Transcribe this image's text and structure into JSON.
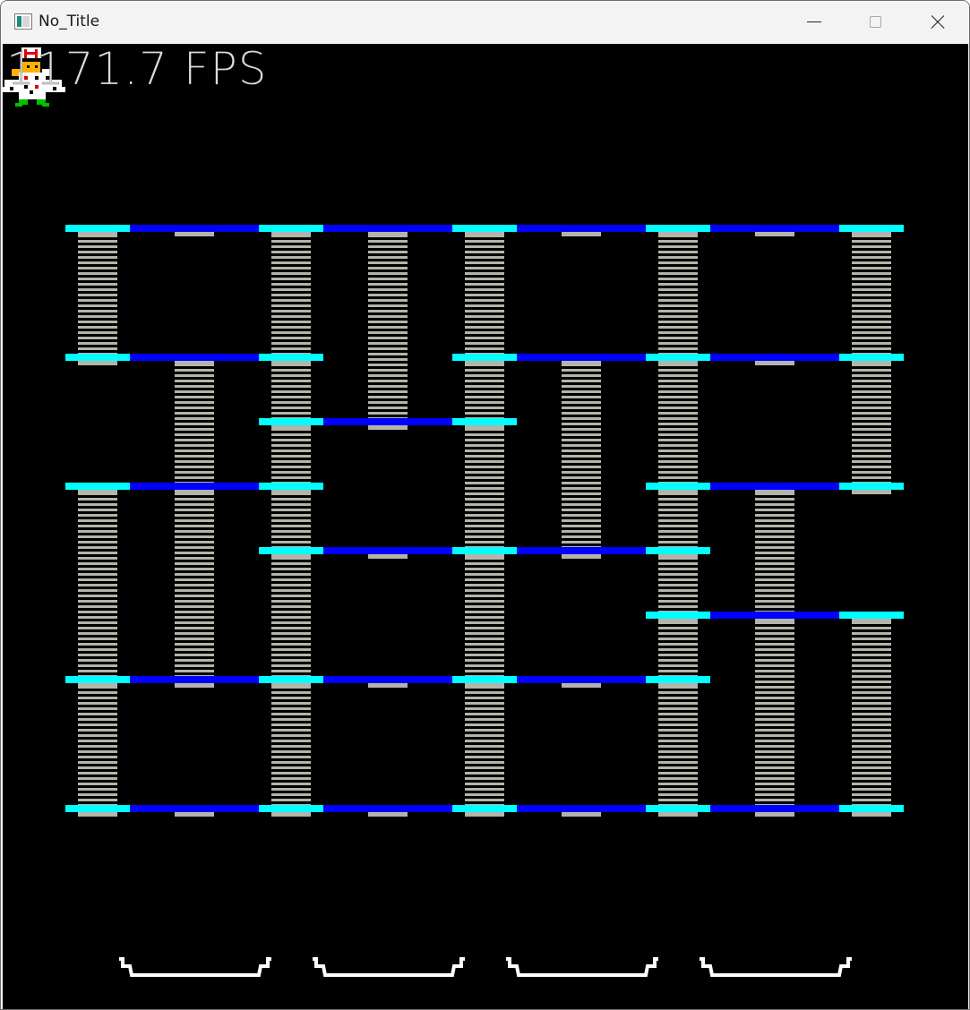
{
  "window": {
    "title": "No_Title"
  },
  "hud": {
    "fps_text": "1171.7 FPS"
  },
  "colors": {
    "background": "#000000",
    "floor": "#0000ff",
    "floor_joint": "#00ffff",
    "ladder_rung": "#b4b4aa",
    "plate": "#ffffff"
  },
  "player": {
    "sprite": "chef-sprite"
  },
  "level": {
    "floors": 9,
    "ladders": 21,
    "plates": 4
  }
}
